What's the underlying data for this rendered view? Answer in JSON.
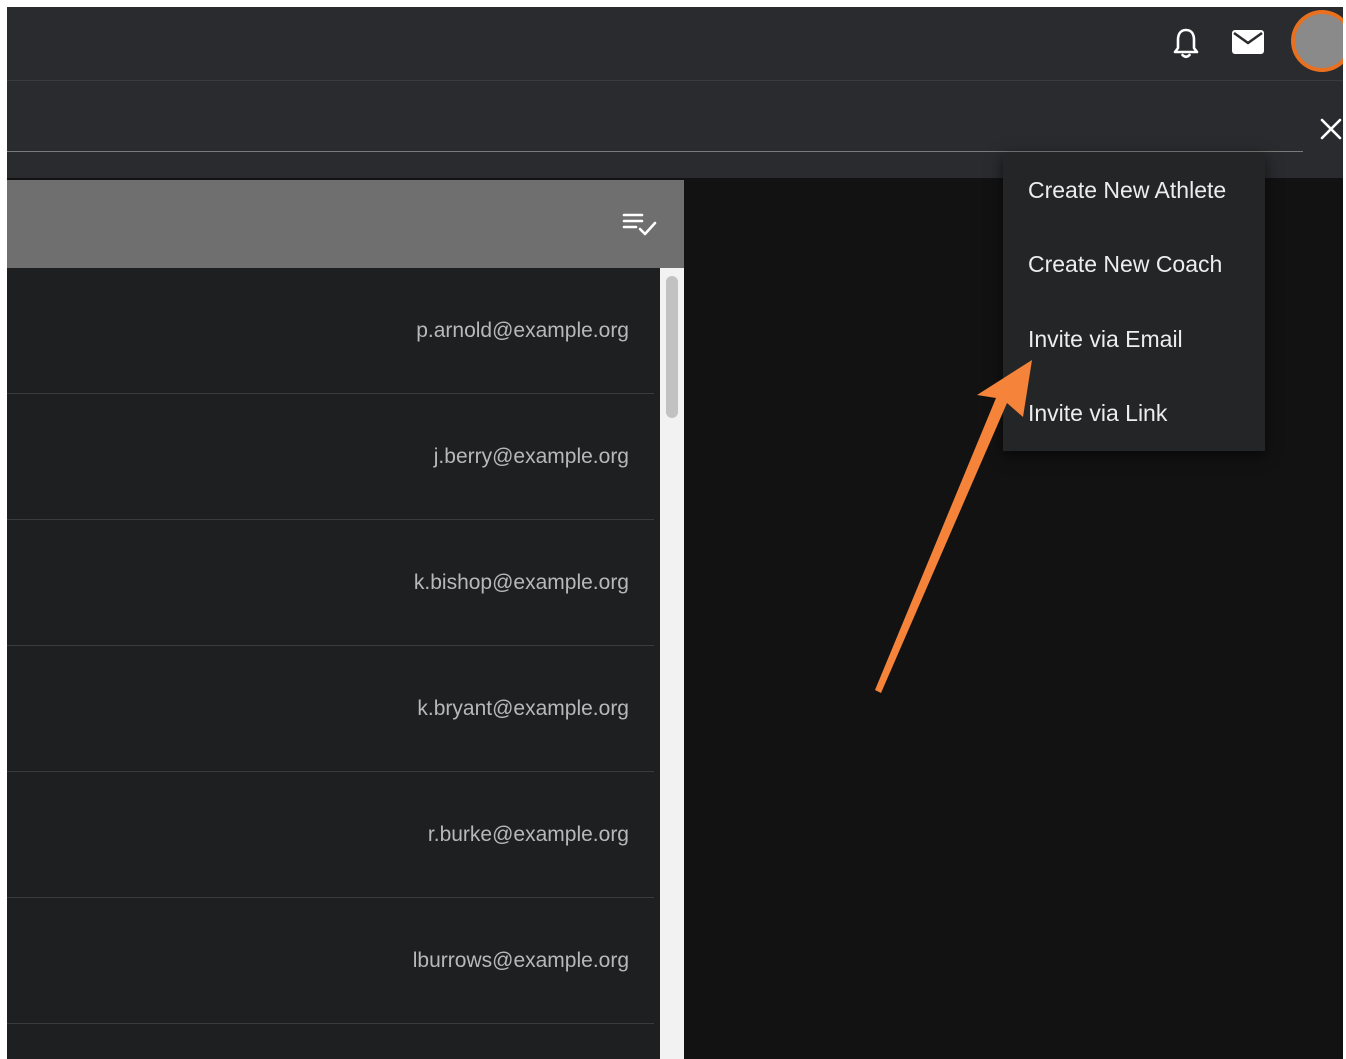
{
  "topbar": {
    "icons": [
      "bell-icon",
      "mail-icon"
    ],
    "avatar_ring_color": "#e8701f"
  },
  "search": {
    "value": "",
    "placeholder": ""
  },
  "list": {
    "header_icon": "checklist-icon",
    "rows": [
      {
        "email": "p.arnold@example.org"
      },
      {
        "email": "j.berry@example.org"
      },
      {
        "email": "k.bishop@example.org"
      },
      {
        "email": "k.bryant@example.org"
      },
      {
        "email": "r.burke@example.org"
      },
      {
        "email": "lburrows@example.org"
      }
    ]
  },
  "menu": {
    "items": [
      {
        "label": "Create New Athlete"
      },
      {
        "label": "Create New Coach"
      },
      {
        "label": "Invite via Email"
      },
      {
        "label": "Invite via Link"
      }
    ]
  },
  "annotation": {
    "arrow_color": "#f5843a",
    "points_to": "Invite via Email"
  }
}
